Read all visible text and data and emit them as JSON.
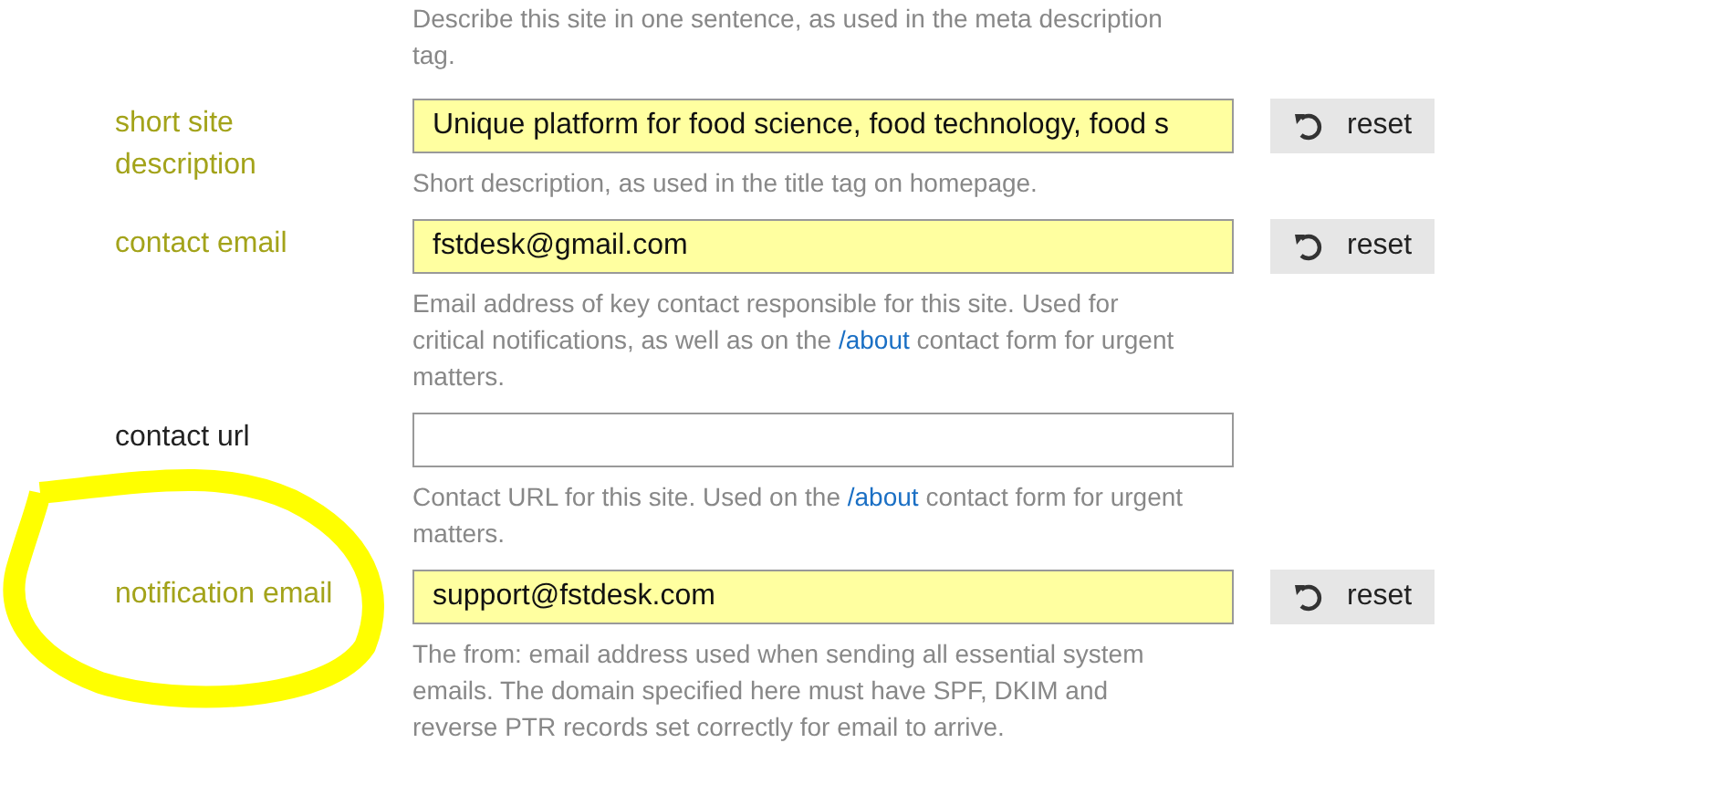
{
  "intro_help": "Describe this site in one sentence, as used in the meta description tag.",
  "settings": [
    {
      "label": "short site description",
      "value": "Unique platform for food science, food technology, food s",
      "modified": true,
      "annotated": false,
      "reset": "reset",
      "help": [
        {
          "kind": "text",
          "text": "Short description, as used in the title tag on homepage."
        }
      ]
    },
    {
      "label": "contact email",
      "value": "fstdesk@gmail.com",
      "modified": true,
      "annotated": false,
      "reset": "reset",
      "help": [
        {
          "kind": "text",
          "text": "Email address of key contact responsible for this site. Used for critical notifications, as well as on the "
        },
        {
          "kind": "link",
          "text": "/about"
        },
        {
          "kind": "text",
          "text": " contact form for urgent matters."
        }
      ]
    },
    {
      "label": "contact url",
      "modified": false,
      "annotated": false,
      "help": [
        {
          "kind": "text",
          "text": "Contact URL for this site. Used on the "
        },
        {
          "kind": "link",
          "text": "/about"
        },
        {
          "kind": "text",
          "text": " contact form for urgent matters."
        }
      ]
    },
    {
      "label": "notification email",
      "value": "support@fstdesk.com",
      "modified": true,
      "annotated": true,
      "reset": "reset",
      "help": [
        {
          "kind": "text",
          "text": "The from: email address used when sending all essential system emails. The domain specified here must have SPF, DKIM and reverse PTR records set correctly for email to arrive."
        }
      ]
    }
  ]
}
